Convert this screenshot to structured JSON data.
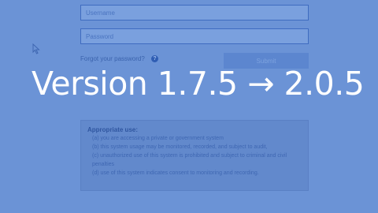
{
  "login": {
    "username_placeholder": "Username",
    "password_placeholder": "Password",
    "forgot_password": "Forgot your password?",
    "help_icon": "?",
    "submit_label": "Submit"
  },
  "overlay": {
    "version_text": "Version 1.7.5 → 2.0.5"
  },
  "notice": {
    "title": "Appropriate use:",
    "items": [
      "(a) you are accessing a private or government system",
      "(b) this system usage may be monitored, recorded, and subject to audit,",
      "(c) unauthorized use of this system is prohibited and subject to criminal and civil penalties",
      "(d) use of this system indicates consent to monitoring and recording."
    ]
  },
  "colors": {
    "background": "#6b93d6",
    "overlay_text": "#ffffff"
  }
}
